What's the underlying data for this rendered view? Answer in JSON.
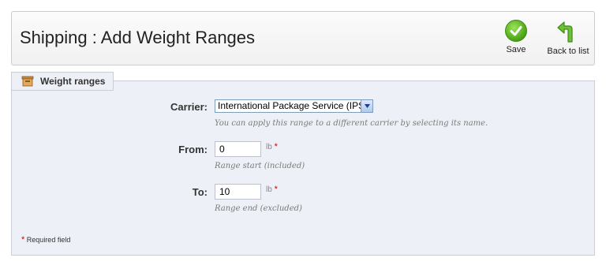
{
  "header": {
    "title": "Shipping : Add Weight Ranges",
    "save_label": "Save",
    "back_label": "Back to list"
  },
  "fieldset": {
    "legend": "Weight ranges",
    "legend_icon": "box-icon"
  },
  "form": {
    "carrier": {
      "label": "Carrier:",
      "selected": "International Package Service (IPS)",
      "hint": "You can apply this range to a different carrier by selecting its name."
    },
    "from": {
      "label": "From:",
      "value": "0",
      "unit": "lb",
      "required": "*",
      "hint": "Range start (included)"
    },
    "to": {
      "label": "To:",
      "value": "10",
      "unit": "lb",
      "required": "*",
      "hint": "Range end (excluded)"
    }
  },
  "footer": {
    "required_star": "*",
    "required_note": "Required field"
  },
  "colors": {
    "save_green": "#4aa315",
    "required_red": "#cc0000",
    "fieldset_bg": "#eef0f7"
  }
}
